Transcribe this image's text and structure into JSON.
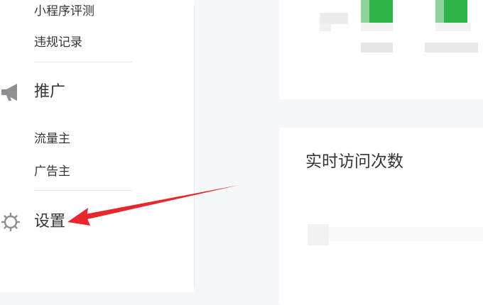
{
  "sidebar": {
    "items_top": [
      {
        "label": "小程序评测"
      },
      {
        "label": "违规记录"
      }
    ],
    "promotion": {
      "label": "推广",
      "icon": "megaphone-icon",
      "items": [
        {
          "label": "流量主"
        },
        {
          "label": "广告主"
        }
      ]
    },
    "settings": {
      "label": "设置",
      "icon": "gear-icon"
    }
  },
  "main": {
    "realtime_card": {
      "title": "实时访问次数"
    }
  },
  "colors": {
    "accent_green": "#2fb44a",
    "annotation_red": "#e8262b",
    "divider": "#e7e7eb"
  }
}
